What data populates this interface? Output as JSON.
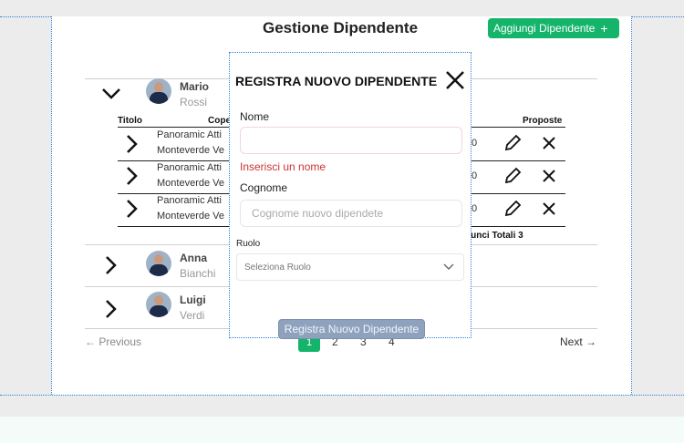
{
  "page": {
    "title": "Gestione Dipendente",
    "add_button": "Aggiungi Dipendente",
    "add_icon": "+"
  },
  "employees": [
    {
      "first": "Mario",
      "last": "Rossi"
    },
    {
      "first": "Anna",
      "last": "Bianchi"
    },
    {
      "first": "Luigi",
      "last": "Verdi"
    }
  ],
  "subtable": {
    "headers": {
      "titolo": "Titolo",
      "copertina": "Cope",
      "proposte": "Proposte"
    },
    "rows": [
      {
        "line1": "Panoramic Atti",
        "line2": "Monteverde Ve",
        "value": "0"
      },
      {
        "line1": "Panoramic Atti",
        "line2": "Monteverde Ve",
        "value": "0"
      },
      {
        "line1": "Panoramic Atti",
        "line2": "Monteverde Ve",
        "value": "0"
      }
    ],
    "totals": "nunci Totali 3"
  },
  "pagination": {
    "previous": "← Previous",
    "next": "Next →",
    "pages": [
      "1",
      "2",
      "3",
      "4"
    ],
    "current": "1"
  },
  "modal": {
    "title": "REGISTRA NUOVO DIPENDENTE",
    "nome_label": "Nome",
    "nome_value": "",
    "nome_error": "Inserisci un nome",
    "cognome_label": "Cognome",
    "cognome_placeholder": "Cognome nuovo dipendete",
    "ruolo_label": "Ruolo",
    "ruolo_selected": "Seleziona Ruolo",
    "submit": "Registra Nuovo Dipendente"
  },
  "colors": {
    "accent": "#14b46a",
    "error": "#cc3333",
    "disabled_button": "#8fa2bd"
  }
}
